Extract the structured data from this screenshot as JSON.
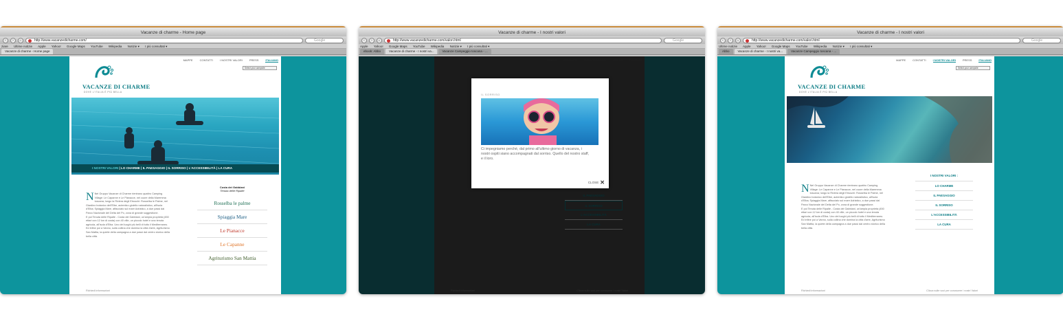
{
  "browser": {
    "bookmarks": [
      "Ultime notizie",
      "Apple",
      "Yahoo!",
      "Google Maps",
      "YouTube",
      "Wikipedia",
      "Notizie ▾",
      "I più consultati ▾"
    ],
    "search_placeholder": "Google"
  },
  "site": {
    "brand": "VACANZE DI CHARME",
    "tagline": "DOVE L'ITALIA È PIÙ BELLA",
    "topnav": [
      "MAPPE",
      "CONTATTI",
      "I NOSTRI VALORI",
      "PRESS",
      "ITALIANO"
    ],
    "selector": "Select your campsite"
  },
  "windows": [
    {
      "title": "Vacanze di charme - Home page",
      "url": "http://www.vacanzedicharme.com/",
      "bm_prefix": "ziare",
      "tabs": [
        "Vacanze di charme - Home page"
      ],
      "strip": {
        "current": "I NOSTRI VALORI",
        "rest": " | LO CHARME | IL PAESAGGIO | IL SORRISO | L'ACCESSIBILITÀ | LA CURA"
      },
      "intro": "Nel Gruppo Vacanze di Charme rientrano quattro Camping Village: Le Capanne e Le Pianacce, nel cuore della Maremma toscana; lungo la Riviera degli Etruschi: Rosselba le Palme, nel Giardino botanico dell'Elbe, autentico gioiello naturalistico, all'isola d'Elba; Spiaggia Mare, affacciato sul mare Adriatico, a due passi dal Parco Nazionale del Delta del Po, zona di grande suggestione.",
      "intro2": "E poi Tenuta delle Ripalte - Costa dei Gabbiani, un'ampia proprietà (450 ettari con 12 km di costa) con 40 ville, un piccolo hotel e una tenuta agricola, all'isola d'Elba. Uno dei luoghi più belli di tutto il Mediterraneo. Ed infine poi a Vanno, sulla collina che domina la città d'arte, Agriturismo San Mattia, la quiete della campagna a due passi dal centro storico della bella città.",
      "costa": "Costa dei Gabbiani",
      "costa_sub": "Tenuta delle Ripalte",
      "properties": [
        {
          "name": "Rosselba le palme",
          "color": "#1f6f55"
        },
        {
          "name": "Spiaggia Mare",
          "color": "#1e5f86"
        },
        {
          "name": "Le Pianacce",
          "color": "#c0392b"
        },
        {
          "name": "Le Capanne",
          "color": "#e0762a"
        },
        {
          "name": "Agriturismo San Mattia",
          "color": "#3f5d2a"
        }
      ],
      "footer": "Richiedi informazioni"
    },
    {
      "title": "Vacanze di charme - I nostri valori",
      "url": "http://www.vacanzedicharme.com/valori.html",
      "bm_prefix": "ebook: Abbo",
      "tabs": [
        "Vacanze di charme - I nostri va...",
        "Vacanze Campeggio toscana - ..."
      ],
      "modal": {
        "title": "IL SORRISO",
        "text": "Ci impegniamo perché, dal primo all'ultimo giorno di vacanza, i nostri ospiti siano accompagnati dal sorriso. Quello del nostro staff, e il loro.",
        "close": "CLOSE"
      },
      "menu": [
        "IL PAESAGGIO",
        "IL SORRISO",
        "L'ACCESSIBILITÀ",
        "LA CURA"
      ],
      "footer": "Richiedi informazioni",
      "footer2": "Clicca sulle voci per conoscere i nostri Valori"
    },
    {
      "title": "Vacanze di charme - I nostri valori",
      "url": "http://www.vacanzedicharme.com/valori.html",
      "bm_prefix": "Ultime notizie",
      "tabs": [
        "Vacanze di charme - I nostri va...",
        "Vacanze Campeggio toscana - ..."
      ],
      "values_head": "I NOSTRI VALORI :",
      "menu": [
        "LO CHARME",
        "IL PAESAGGIO",
        "IL SORRISO",
        "L'ACCESSIBILITÀ",
        "LA CURA"
      ],
      "footer": "Richiedi informazioni",
      "footer2": "Clicca sulle voci per conoscere i nostri Valori"
    }
  ]
}
